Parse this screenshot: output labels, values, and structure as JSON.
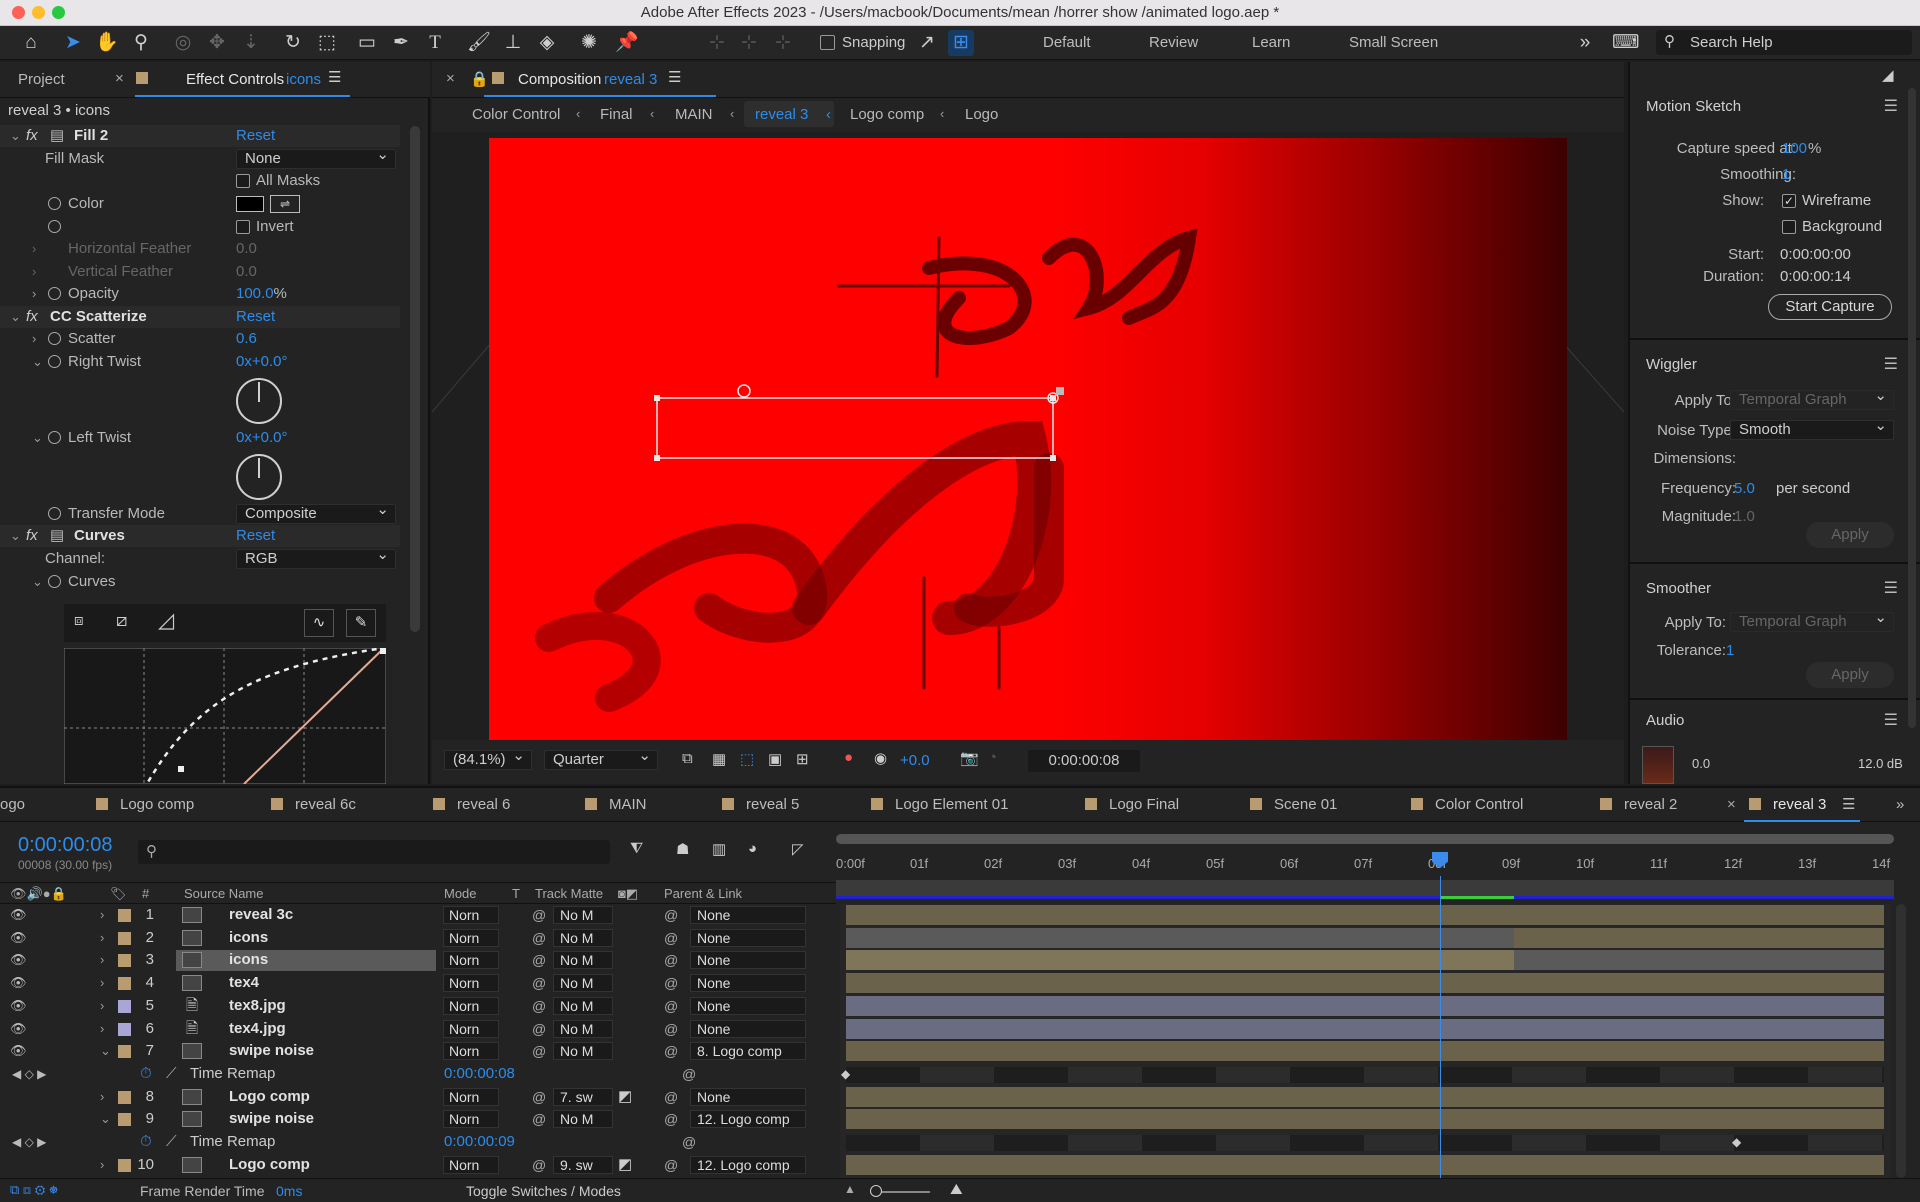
{
  "window": {
    "title": "Adobe After Effects 2023 - /Users/macbook/Documents/mean /horrer show /animated logo.aep *"
  },
  "toolbar": {
    "snapping_label": "Snapping",
    "workspaces": [
      "Default",
      "Review",
      "Learn",
      "Small Screen"
    ],
    "search_placeholder": "Search Help"
  },
  "left_panel": {
    "tab_project": "Project",
    "tab_effect_controls": "Effect Controls",
    "tab_effect_target": "icons",
    "subtitle": "reveal 3 • icons",
    "fill": {
      "name": "Fill 2",
      "reset": "Reset",
      "fill_mask_label": "Fill Mask",
      "fill_mask_value": "None",
      "all_masks": "All Masks",
      "color_label": "Color",
      "invert": "Invert",
      "h_feather_label": "Horizontal Feather",
      "h_feather_value": "0.0",
      "v_feather_label": "Vertical Feather",
      "v_feather_value": "0.0",
      "opacity_label": "Opacity",
      "opacity_value": "100.0",
      "opacity_unit": "%"
    },
    "scatterize": {
      "name": "CC Scatterize",
      "reset": "Reset",
      "scatter_label": "Scatter",
      "scatter_value": "0.6",
      "right_twist_label": "Right Twist",
      "right_twist_value": "0x+0.0°",
      "left_twist_label": "Left Twist",
      "left_twist_value": "0x+0.0°",
      "transfer_label": "Transfer Mode",
      "transfer_value": "Composite"
    },
    "curves": {
      "name": "Curves",
      "reset": "Reset",
      "channel_label": "Channel:",
      "channel_value": "RGB",
      "curves_label": "Curves"
    }
  },
  "composition": {
    "tab_label": "Composition",
    "tab_name": "reveal 3",
    "breadcrumbs": [
      "Color Control",
      "Final",
      "MAIN",
      "reveal 3",
      "Logo comp",
      "Logo"
    ],
    "active_breadcrumb": "reveal 3",
    "zoom": "(84.1%)",
    "resolution": "Quarter",
    "exposure": "+0.0",
    "timecode": "0:00:00:08"
  },
  "right_panel": {
    "motion_sketch": {
      "title": "Motion Sketch",
      "capture_label": "Capture speed at:",
      "capture_value": "100",
      "capture_unit": "%",
      "smoothing_label": "Smoothing:",
      "smoothing_value": "1",
      "show_label": "Show:",
      "wireframe": "Wireframe",
      "background": "Background",
      "start_label": "Start:",
      "start_value": "0:00:00:00",
      "duration_label": "Duration:",
      "duration_value": "0:00:00:14",
      "button": "Start Capture"
    },
    "wiggler": {
      "title": "Wiggler",
      "apply_to_label": "Apply To:",
      "apply_to_value": "Temporal Graph",
      "noise_label": "Noise Type:",
      "noise_value": "Smooth",
      "dimensions_label": "Dimensions:",
      "frequency_label": "Frequency:",
      "frequency_value": "5.0",
      "frequency_unit": "per second",
      "magnitude_label": "Magnitude:",
      "magnitude_value": "1.0",
      "apply": "Apply"
    },
    "smoother": {
      "title": "Smoother",
      "apply_to_label": "Apply To:",
      "apply_to_value": "Temporal Graph",
      "tolerance_label": "Tolerance:",
      "tolerance_value": "1",
      "apply": "Apply"
    },
    "audio": {
      "title": "Audio",
      "level_left": "0.0",
      "level_right": "12.0 dB"
    }
  },
  "timeline": {
    "tabs": [
      "ogo",
      "Logo comp",
      "reveal 6c",
      "reveal 6",
      "MAIN",
      "reveal 5",
      "Logo Element 01",
      "Logo Final",
      "Scene 01",
      "Color Control",
      "reveal 2",
      "reveal 3"
    ],
    "active_tab": "reveal 3",
    "current_time": "0:00:00:08",
    "frame_info": "00008 (30.00 fps)",
    "columns": {
      "num": "#",
      "source": "Source Name",
      "mode": "Mode",
      "t": "T",
      "track_matte": "Track Matte",
      "parent": "Parent & Link"
    },
    "ruler": [
      "0:00f",
      "01f",
      "02f",
      "03f",
      "04f",
      "05f",
      "06f",
      "07f",
      "08f",
      "09f",
      "10f",
      "11f",
      "12f",
      "13f",
      "14f"
    ],
    "layers": [
      {
        "num": "1",
        "name": "reveal 3c",
        "mode": "Norn",
        "matte": "No M",
        "parent": "None"
      },
      {
        "num": "2",
        "name": "icons",
        "mode": "Norn",
        "matte": "No M",
        "parent": "None"
      },
      {
        "num": "3",
        "name": "icons",
        "mode": "Norn",
        "matte": "No M",
        "parent": "None"
      },
      {
        "num": "4",
        "name": "tex4",
        "mode": "Norn",
        "matte": "No M",
        "parent": "None"
      },
      {
        "num": "5",
        "name": "tex8.jpg",
        "mode": "Norn",
        "matte": "No M",
        "parent": "None"
      },
      {
        "num": "6",
        "name": "tex4.jpg",
        "mode": "Norn",
        "matte": "No M",
        "parent": "None"
      },
      {
        "num": "7",
        "name": "swipe noise",
        "mode": "Norn",
        "matte": "No M",
        "parent": "8. Logo comp"
      },
      {
        "num": "8",
        "name": "Logo comp",
        "mode": "Norn",
        "matte": "7. sw",
        "parent": "None"
      },
      {
        "num": "9",
        "name": "swipe noise",
        "mode": "Norn",
        "matte": "No M",
        "parent": "12. Logo comp"
      },
      {
        "num": "10",
        "name": "Logo comp",
        "mode": "Norn",
        "matte": "9. sw",
        "parent": "12. Logo comp"
      }
    ],
    "time_remap_label": "Time Remap",
    "time_remap_7": "0:00:00:08",
    "time_remap_9": "0:00:00:09",
    "footer_render_label": "Frame Render Time",
    "footer_render_value": "0ms",
    "footer_toggle": "Toggle Switches / Modes"
  }
}
